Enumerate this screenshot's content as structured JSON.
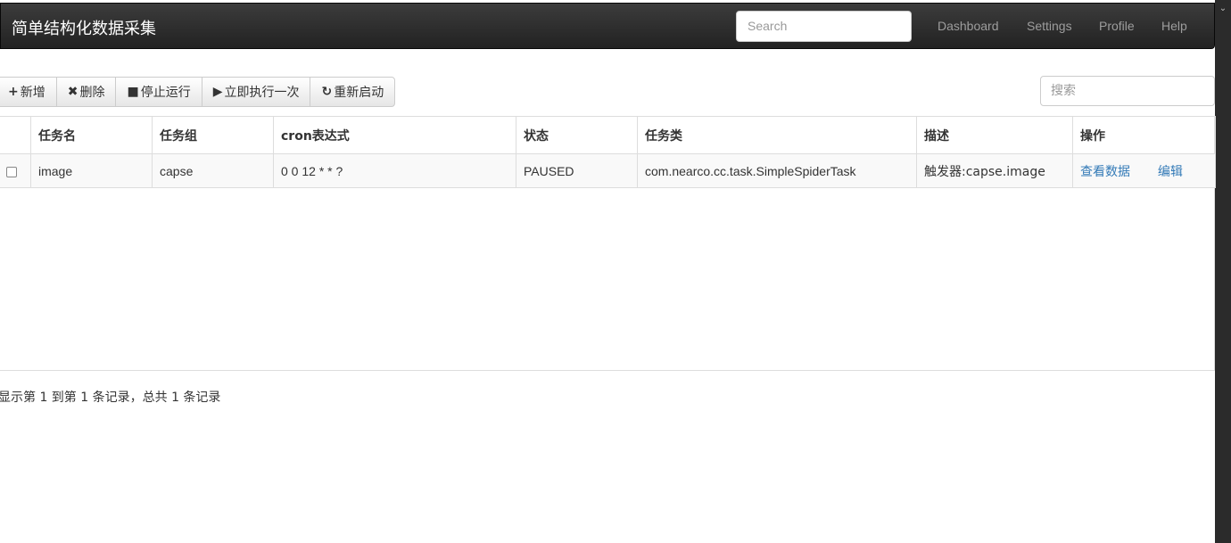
{
  "navbar": {
    "brand": "简单结构化数据采集",
    "search_placeholder": "Search",
    "links": [
      "Dashboard",
      "Settings",
      "Profile",
      "Help"
    ]
  },
  "toolbar": {
    "buttons": [
      {
        "icon": "+",
        "label": "新增"
      },
      {
        "icon": "✖",
        "label": "删除"
      },
      {
        "icon": "■",
        "label": "停止运行"
      },
      {
        "icon": "▶",
        "label": "立即执行一次"
      },
      {
        "icon": "↻",
        "label": "重新启动"
      }
    ],
    "search_placeholder": "搜索"
  },
  "table": {
    "headers": [
      "",
      "任务名",
      "任务组",
      "cron表达式",
      "状态",
      "任务类",
      "描述",
      "操作"
    ],
    "rows": [
      {
        "name": "image",
        "group": "capse",
        "cron": "0 0 12 * * ?",
        "status": "PAUSED",
        "class": "com.nearco.cc.task.SimpleSpiderTask",
        "desc": "触发器:capse.image",
        "actions": [
          "查看数据",
          "编辑"
        ]
      }
    ]
  },
  "pagination": {
    "info": "显示第 1 到第 1 条记录，总共 1 条记录"
  }
}
